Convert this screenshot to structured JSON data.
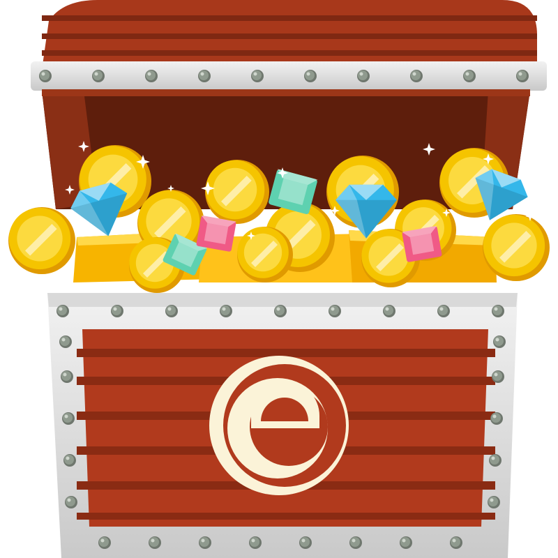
{
  "illustration": {
    "subject": "treasure-chest",
    "emblem_letter": "e"
  },
  "colors": {
    "background": "#ffffff",
    "wood_dark": "#7a2a12",
    "wood_mid": "#b13a1d",
    "wood_stripe": "#8e2d14",
    "interior": "#5e1e0c",
    "metal_band": "#e6e6e6",
    "metal_shade": "#b8b8b8",
    "rivet": "#8f9a8e",
    "gold": "#f5c400",
    "gold_light": "#ffe45a",
    "gold_dark": "#e09a00",
    "diamond_blue": "#34b7ea",
    "diamond_green": "#5ed1b0",
    "diamond_pink": "#f05a86",
    "emblem": "#fbf3d8"
  },
  "icons": [
    "gold-coin-icon",
    "blue-diamond-icon",
    "green-gem-icon",
    "pink-gem-icon",
    "sparkle-icon",
    "rivet-icon"
  ]
}
